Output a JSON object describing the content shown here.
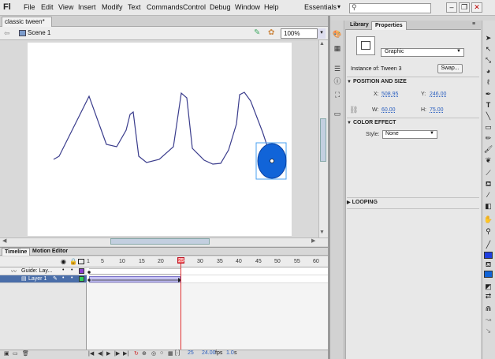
{
  "app": {
    "logo": "Fl",
    "menus": [
      "File",
      "Edit",
      "View",
      "Insert",
      "Modify",
      "Text",
      "Commands",
      "Control",
      "Debug",
      "Window",
      "Help"
    ],
    "workspace": "Essentials",
    "search_placeholder": ""
  },
  "document": {
    "tab_title": "classic tween*",
    "scene": "Scene 1",
    "zoom": "100%"
  },
  "timeline": {
    "tabs": [
      "Timeline",
      "Motion Editor"
    ],
    "frame_ticks": [
      "1",
      "5",
      "10",
      "15",
      "20",
      "25",
      "30",
      "35",
      "40",
      "45",
      "50",
      "55",
      "60"
    ],
    "layers": [
      {
        "name": "Guide: Lay...",
        "type": "guide"
      },
      {
        "name": "Layer 1",
        "type": "normal",
        "selected": true
      }
    ],
    "current_frame": "25",
    "fps": "24.00",
    "fps_unit": "fps",
    "elapsed": "1.0",
    "elapsed_unit": "s"
  },
  "panel": {
    "tabs": [
      "Library",
      "Properties"
    ],
    "active_tab": "Properties",
    "symbol_type": "Graphic",
    "instance_of_label": "Instance of:",
    "instance_of": "Tween 3",
    "swap_label": "Swap...",
    "position_size": {
      "title": "POSITION AND SIZE",
      "x_label": "X:",
      "x": "508.95",
      "y_label": "Y:",
      "y": "246.00",
      "w_label": "W:",
      "w": "60.00",
      "h_label": "H:",
      "h": "75.00"
    },
    "color_effect": {
      "title": "COLOR EFFECT",
      "style_label": "Style:",
      "style": "None"
    },
    "looping": {
      "title": "LOOPING"
    }
  },
  "colors": {
    "ellipse_fill": "#1164d8",
    "stroke_swatch": "#1f3fe0",
    "tween_span": "#c6c3f1",
    "playhead": "#e03030",
    "selected_layer": "#4a6ea9"
  }
}
